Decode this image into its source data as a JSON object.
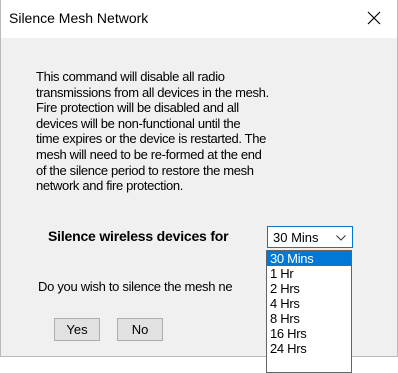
{
  "dialog": {
    "title": "Silence Mesh Network",
    "body": "This command will disable all radio\ntransmissions from all devices in the mesh.\nFire protection will be disabled and all\ndevices will be non-functional until the\ntime expires or the device is restarted. The\nmesh will need to be re-formed at the end\nof the silence period to restore the mesh\nnetwork and fire protection.",
    "silence_label": "Silence wireless devices for",
    "duration_select": {
      "selected": "30 Mins",
      "options": [
        "30 Mins",
        "1 Hr",
        "2 Hrs",
        "4 Hrs",
        "8 Hrs",
        "16 Hrs",
        "24 Hrs"
      ]
    },
    "question": "Do you wish to silence the mesh ne",
    "buttons": {
      "yes": "Yes",
      "no": "No"
    }
  },
  "icons": {
    "close": "close-icon",
    "dropdown": "chevron-down-icon"
  },
  "colors": {
    "accent": "#0078d7",
    "dialog_bg": "#f0f0f0",
    "titlebar_bg": "#ffffff"
  }
}
